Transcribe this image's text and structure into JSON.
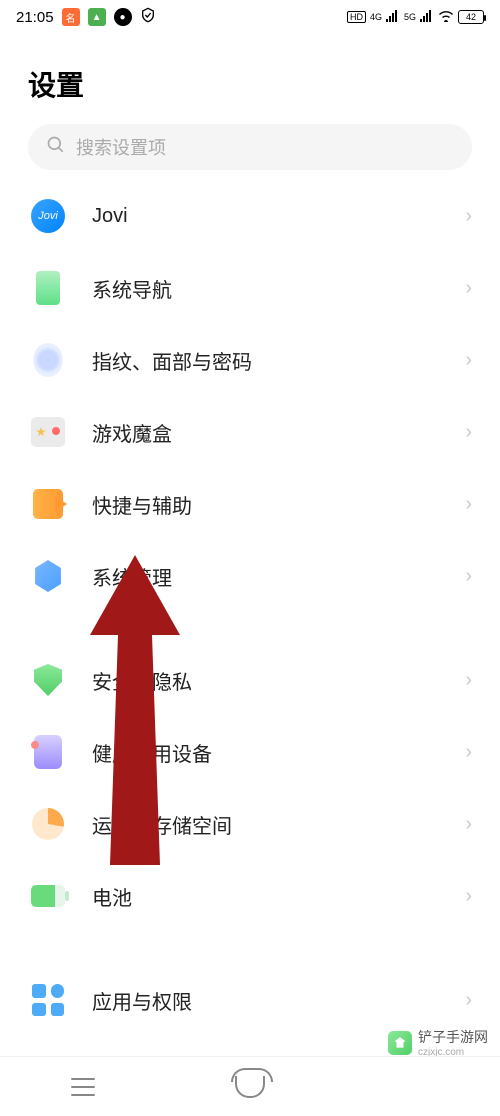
{
  "status": {
    "time": "21:05",
    "hd_badge": "HD",
    "net1": "4G",
    "net2": "5G",
    "battery": "42"
  },
  "header": {
    "title": "设置"
  },
  "search": {
    "placeholder": "搜索设置项"
  },
  "items": {
    "jovi": "Jovi",
    "nav": "系统导航",
    "fingerprint": "指纹、面部与密码",
    "gamebox": "游戏魔盒",
    "shortcut": "快捷与辅助",
    "system": "系统管理",
    "security": "安全与隐私",
    "health": "健康使用设备",
    "storage": "运存与存储空间",
    "battery": "电池",
    "apps": "应用与权限"
  },
  "watermark": {
    "name": "铲子手游网",
    "url": "czjxjc.com"
  }
}
